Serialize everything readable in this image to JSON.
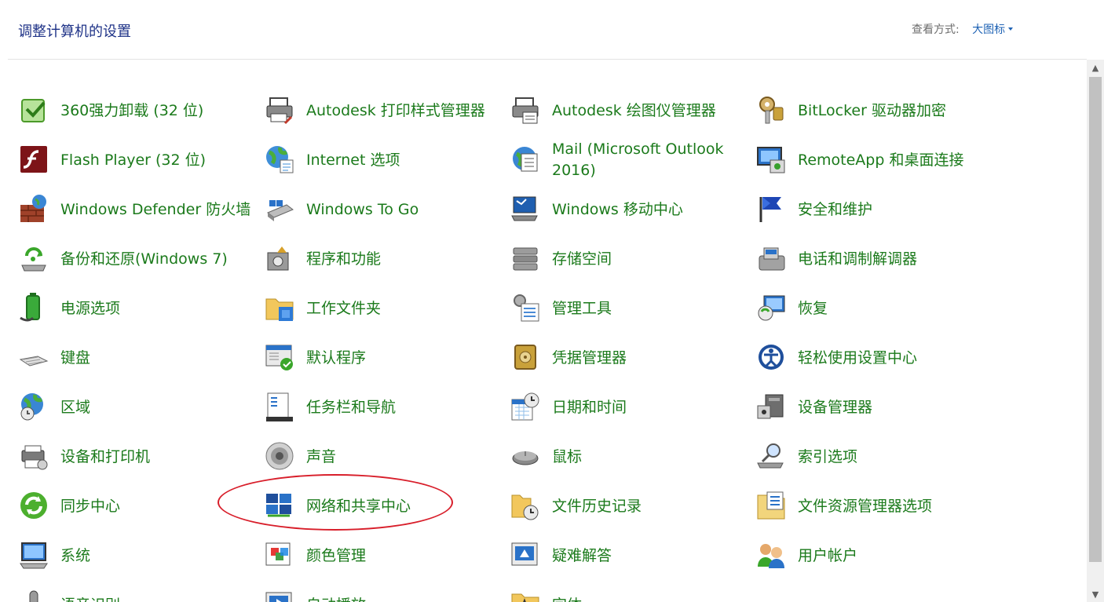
{
  "header": {
    "title": "调整计算机的设置",
    "view_by_label": "查看方式:",
    "view_by_value": "大图标"
  },
  "items": [
    {
      "label": "360强力卸载 (32 位)",
      "icon": "uninstall-icon"
    },
    {
      "label": "Autodesk 打印样式管理器",
      "icon": "printer-style-icon"
    },
    {
      "label": "Autodesk 绘图仪管理器",
      "icon": "plotter-icon"
    },
    {
      "label": "BitLocker 驱动器加密",
      "icon": "bitlocker-key-icon"
    },
    {
      "label": "Flash Player (32 位)",
      "icon": "flash-icon"
    },
    {
      "label": "Internet 选项",
      "icon": "globe-icon"
    },
    {
      "label": "Mail (Microsoft Outlook 2016)",
      "icon": "mail-icon"
    },
    {
      "label": "RemoteApp 和桌面连接",
      "icon": "remote-desktop-icon"
    },
    {
      "label": "Windows Defender 防火墙",
      "icon": "firewall-icon"
    },
    {
      "label": "Windows To Go",
      "icon": "usb-drive-icon"
    },
    {
      "label": "Windows 移动中心",
      "icon": "mobility-center-icon"
    },
    {
      "label": "安全和维护",
      "icon": "flag-icon"
    },
    {
      "label": "备份和还原(Windows 7)",
      "icon": "backup-icon"
    },
    {
      "label": "程序和功能",
      "icon": "programs-icon"
    },
    {
      "label": "存储空间",
      "icon": "storage-icon"
    },
    {
      "label": "电话和调制解调器",
      "icon": "phone-icon"
    },
    {
      "label": "电源选项",
      "icon": "power-icon"
    },
    {
      "label": "工作文件夹",
      "icon": "work-folder-icon"
    },
    {
      "label": "管理工具",
      "icon": "admin-tools-icon"
    },
    {
      "label": "恢复",
      "icon": "recovery-icon"
    },
    {
      "label": "键盘",
      "icon": "keyboard-icon"
    },
    {
      "label": "默认程序",
      "icon": "default-programs-icon"
    },
    {
      "label": "凭据管理器",
      "icon": "credential-vault-icon"
    },
    {
      "label": "轻松使用设置中心",
      "icon": "ease-of-access-icon"
    },
    {
      "label": "区域",
      "icon": "region-globe-icon"
    },
    {
      "label": "任务栏和导航",
      "icon": "taskbar-icon"
    },
    {
      "label": "日期和时间",
      "icon": "calendar-clock-icon"
    },
    {
      "label": "设备管理器",
      "icon": "device-manager-icon"
    },
    {
      "label": "设备和打印机",
      "icon": "devices-printers-icon"
    },
    {
      "label": "声音",
      "icon": "speaker-icon"
    },
    {
      "label": "鼠标",
      "icon": "mouse-icon"
    },
    {
      "label": "索引选项",
      "icon": "index-options-icon"
    },
    {
      "label": "同步中心",
      "icon": "sync-icon"
    },
    {
      "label": "网络和共享中心",
      "icon": "network-icon"
    },
    {
      "label": "文件历史记录",
      "icon": "file-history-icon"
    },
    {
      "label": "文件资源管理器选项",
      "icon": "folder-options-icon"
    },
    {
      "label": "系统",
      "icon": "system-monitor-icon"
    },
    {
      "label": "颜色管理",
      "icon": "color-management-icon"
    },
    {
      "label": "疑难解答",
      "icon": "troubleshooting-icon"
    },
    {
      "label": "用户帐户",
      "icon": "user-accounts-icon"
    },
    {
      "label": "语音识别",
      "icon": "microphone-icon"
    },
    {
      "label": "自动播放",
      "icon": "autoplay-icon"
    },
    {
      "label": "字体",
      "icon": "fonts-folder-icon"
    }
  ],
  "highlighted_item": "网络和共享中心",
  "colors": {
    "title": "#1e3287",
    "link_green": "#1b7a1b",
    "dropdown_blue": "#1e62b4",
    "annotation_red": "#d81e2a"
  }
}
